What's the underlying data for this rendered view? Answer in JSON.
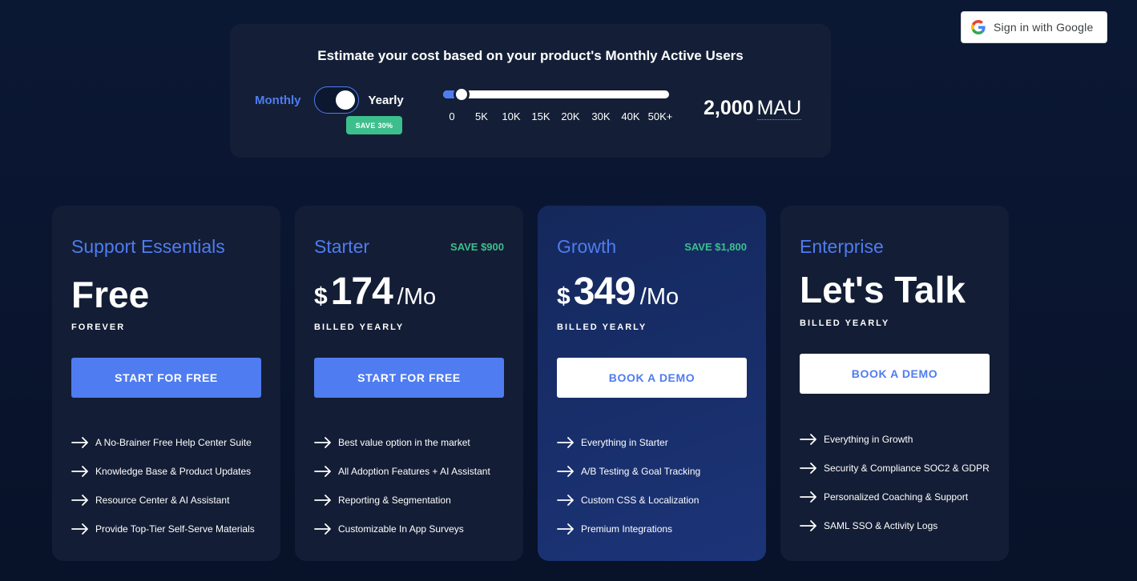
{
  "auth": {
    "google_label": "Sign in with Google",
    "icon": "google-g-logo"
  },
  "estimator": {
    "title": "Estimate your cost based on your product's Monthly Active Users",
    "billing": {
      "monthly_label": "Monthly",
      "yearly_label": "Yearly",
      "selected": "Yearly",
      "save_badge": "SAVE 30%"
    },
    "slider": {
      "ticks": [
        "0",
        "5K",
        "10K",
        "15K",
        "20K",
        "30K",
        "40K",
        "50K+"
      ],
      "value_fraction": 0.08
    },
    "mau_value": "2,000",
    "mau_unit": "MAU"
  },
  "colors": {
    "accent": "#4f7cf0",
    "save_green": "#3cbf8c",
    "card_bg": "#131d35",
    "page_bg": "#0a1530"
  },
  "plans": [
    {
      "name": "Support Essentials",
      "save": "",
      "price": "Free",
      "billing_note": "FOREVER",
      "cta": "START FOR FREE",
      "features": [
        "A No-Brainer Free Help Center Suite",
        "Knowledge Base & Product Updates",
        "Resource Center & AI Assistant",
        "Provide Top-Tier Self-Serve Materials"
      ]
    },
    {
      "name": "Starter",
      "save": "SAVE $900",
      "currency": "$",
      "amount": "174",
      "period": "/Mo",
      "billing_note": "BILLED YEARLY",
      "cta": "START FOR FREE",
      "features": [
        "Best value option in the market",
        "All Adoption Features + AI Assistant",
        "Reporting & Segmentation",
        "Customizable In App Surveys"
      ]
    },
    {
      "name": "Growth",
      "save": "SAVE $1,800",
      "currency": "$",
      "amount": "349",
      "period": "/Mo",
      "billing_note": "BILLED YEARLY",
      "cta": "BOOK A DEMO",
      "features": [
        "Everything in Starter",
        "A/B Testing & Goal Tracking",
        "Custom CSS & Localization",
        "Premium Integrations"
      ]
    },
    {
      "name": "Enterprise",
      "save": "",
      "price": "Let's Talk",
      "billing_note": "BILLED YEARLY",
      "cta": "BOOK A DEMO",
      "features": [
        "Everything in Growth",
        "Security & Compliance SOC2 & GDPR",
        "Personalized Coaching & Support",
        "SAML SSO & Activity Logs"
      ]
    }
  ]
}
